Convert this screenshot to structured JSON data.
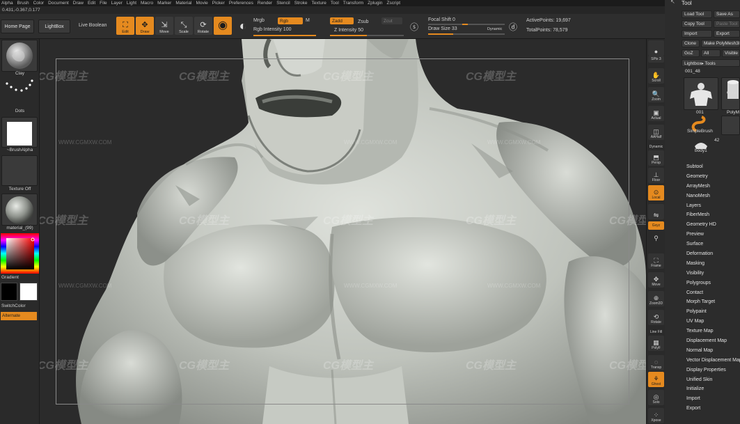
{
  "menu": [
    "Alpha",
    "Brush",
    "Color",
    "Document",
    "Draw",
    "Edit",
    "File",
    "Layer",
    "Light",
    "Macro",
    "Marker",
    "Material",
    "Movie",
    "Picker",
    "Preferences",
    "Render",
    "Stencil",
    "Stroke",
    "Texture",
    "Tool",
    "Transform",
    "Zplugin",
    "Zscript"
  ],
  "coords": "0.431,-0.367,0.177",
  "shelf": {
    "home_page": "Home Page",
    "lightbox": "LightBox",
    "live_boolean": "Live Boolean",
    "edit": "Edit",
    "draw": "Draw",
    "move": "Move",
    "scale": "Scale",
    "rotate": "Rotate",
    "mrgb": "Mrgb",
    "rgb": "Rgb",
    "m": "M",
    "rgb_intensity": "Rgb Intensity 100",
    "zadd": "Zadd",
    "zsub": "Zsub",
    "zcut": "Zcut",
    "z_intensity": "Z Intensity 50",
    "focal_shift": "Focal Shift 0",
    "draw_size": "Draw Size 33",
    "dynamic": "Dynamic",
    "active_points": "ActivePoints: 19,697",
    "total_points": "TotalPoints: 78,579",
    "rgb_intensity_value": 100,
    "z_intensity_value": 50,
    "draw_size_value": 33
  },
  "left": {
    "clay": "Clay",
    "dots": "Dots",
    "brush_alpha": "~BrushAlpha",
    "texture_off": "Texture Off",
    "material": "material_(99)",
    "gradient": "Gradient",
    "switch_color": "SwitchColor",
    "alternate": "Alternate"
  },
  "right": {
    "spix": "SPix 3",
    "scroll": "Scroll",
    "zoom": "Zoom",
    "actual": "Actual",
    "aahalf": "AAHalf",
    "dynamic": "Dynamic",
    "persp": "Persp",
    "floor": "Floor",
    "local": "Local",
    "gxyz": "Gxyz",
    "frame": "Frame",
    "move": "Move",
    "zoom3d": "Zoom3D",
    "rotate": "Rotate",
    "line_fill": "Line Fill",
    "polyf": "PolyF",
    "transp": "Transp",
    "ghost": "Ghost",
    "solo": "Solo",
    "xpose": "Xpose"
  },
  "tool": {
    "title": "Tool",
    "load_tool": "Load Tool",
    "save_as": "Save As",
    "copy_tool": "Copy Tool",
    "paste_tool": "Paste Tool",
    "import": "Import",
    "export": "Export",
    "clone": "Clone",
    "make_polymesh": "Make PolyMesh3D",
    "goz": "GoZ",
    "all": "All",
    "visible": "Visible",
    "lightbox_tools": "Lightbox▸ Tools",
    "current": "001_48",
    "thumb1": "001",
    "thumb2": "Cylin",
    "thumb3": "PolyM",
    "thumb4": "SimpleBrush",
    "thumb5": "body1",
    "thumb5_count": "42",
    "subpalettes": [
      "Subtool",
      "Geometry",
      "ArrayMesh",
      "NanoMesh",
      "Layers",
      "FiberMesh",
      "Geometry HD",
      "Preview",
      "Surface",
      "Deformation",
      "Masking",
      "Visibility",
      "Polygroups",
      "Contact",
      "Morph Target",
      "Polypaint",
      "UV Map",
      "Texture Map",
      "Displacement Map",
      "Normal Map",
      "Vector Displacement Map",
      "Display Properties",
      "Unified Skin",
      "Initialize",
      "Import",
      "Export"
    ]
  },
  "watermarks": {
    "cg": "CG模型主",
    "url": "WWW.CGMXW.COM"
  },
  "colors": {
    "accent": "#e58a1f",
    "background": "#262626",
    "mesh": "#c8cbc5"
  }
}
